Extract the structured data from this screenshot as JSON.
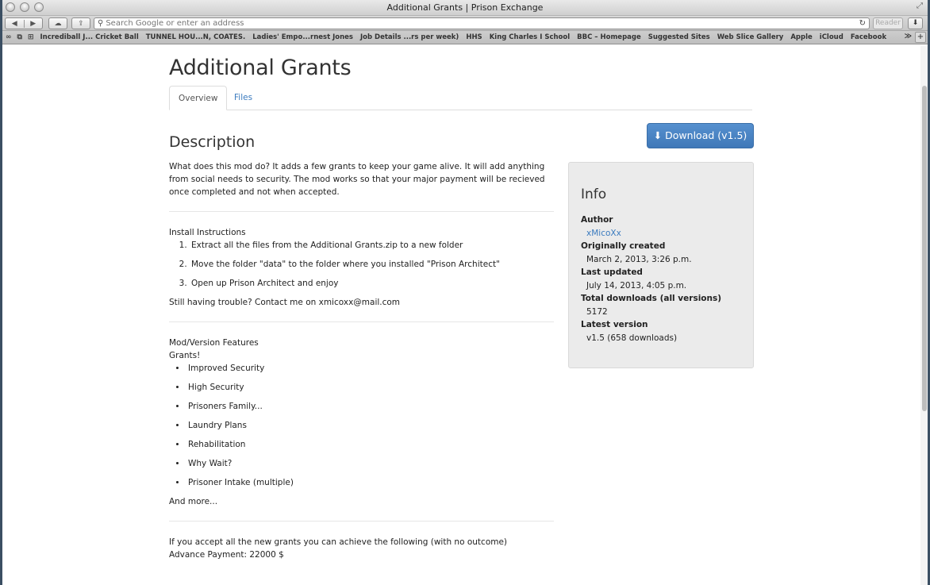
{
  "window": {
    "title": "Additional Grants | Prison Exchange"
  },
  "toolbar": {
    "back_icon": "◀",
    "forward_icon": "▶",
    "address_placeholder": "Search Google or enter an address",
    "reader_label": "Reader"
  },
  "bookmarks": {
    "items": [
      "Incrediball J... Cricket Ball",
      "TUNNEL HOU...N, COATES.",
      "Ladies' Empo...rnest Jones",
      "Job Details ...rs per week)",
      "HHS",
      "King Charles I School",
      "BBC – Homepage",
      "Suggested Sites",
      "Web Slice Gallery",
      "Apple",
      "iCloud",
      "Facebook"
    ]
  },
  "page": {
    "title": "Additional Grants",
    "tabs": [
      "Overview",
      "Files"
    ],
    "description_heading": "Description",
    "download_label": "⬇ Download (v1.5)",
    "intro": "What does this mod do? It adds a few grants to keep your game alive. It will add anything from social needs to security. The mod works so that your major payment will be recieved once completed and not when accepted.",
    "install_heading": "Install Instructions",
    "install_steps": [
      "Extract all the files from the Additional Grants.zip to a new folder",
      "Move the folder \"data\" to the folder where you installed \"Prison Architect\"",
      "Open up Prison Architect and enjoy"
    ],
    "trouble": "Still having trouble? Contact me on xmicoxx@mail.com",
    "features_heading": "Mod/Version Features",
    "grants_label": "Grants!",
    "grants": [
      "Improved Security",
      "High Security",
      "Prisoners Family...",
      "Laundry Plans",
      "Rehabilitation",
      "Why Wait?",
      "Prisoner Intake (multiple)"
    ],
    "and_more": "And more...",
    "accept_text": "If you accept all the new grants you can achieve the following (with no outcome)",
    "advance_payment": "Advance Payment: 22000 $"
  },
  "info": {
    "heading": "Info",
    "author_label": "Author",
    "author": "xMicoXx",
    "created_label": "Originally created",
    "created": "March 2, 2013, 3:26 p.m.",
    "updated_label": "Last updated",
    "updated": "July 14, 2013, 4:05 p.m.",
    "downloads_label": "Total downloads (all versions)",
    "downloads": "5172",
    "latest_label": "Latest version",
    "latest": "v1.5 (658 downloads)"
  }
}
